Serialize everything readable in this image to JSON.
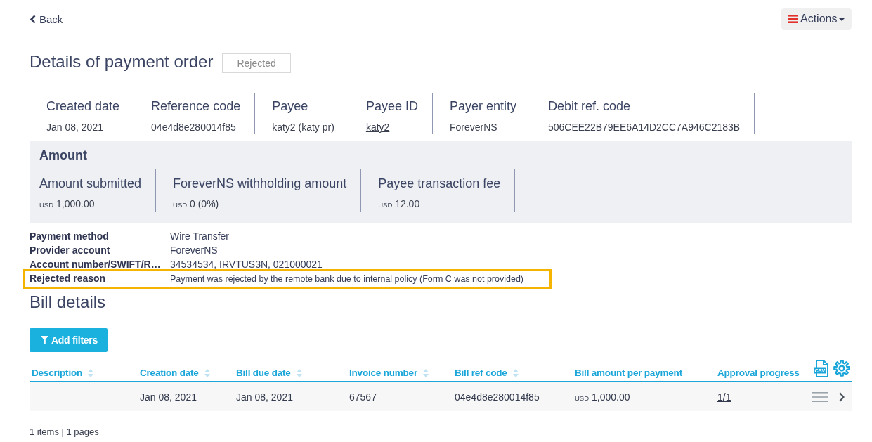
{
  "top_bar": {
    "back_label": "Back",
    "actions_label": "Actions"
  },
  "header": {
    "title": "Details of payment order",
    "status": "Rejected"
  },
  "summary": [
    {
      "label": "Created date",
      "value": "Jan 08, 2021",
      "kind": "text"
    },
    {
      "label": "Reference code",
      "value": "04e4d8e280014f85",
      "kind": "text"
    },
    {
      "label": "Payee",
      "value": "katy2 (katy pr)",
      "kind": "text"
    },
    {
      "label": "Payee ID",
      "value": "katy2",
      "kind": "link"
    },
    {
      "label": "Payer entity",
      "value": "ForeverNS",
      "kind": "text"
    },
    {
      "label": "Debit ref. code",
      "value": "506CEE22B79EE6A14D2CC7A946C2183B",
      "kind": "text"
    }
  ],
  "amount_panel": {
    "title": "Amount",
    "fields": [
      {
        "label": "Amount submitted",
        "currency": "USD",
        "value": "1,000.00"
      },
      {
        "label": "ForeverNS withholding amount",
        "currency": "USD",
        "value": "0 (0%)"
      },
      {
        "label": "Payee transaction fee",
        "currency": "USD",
        "value": "12.00"
      }
    ]
  },
  "details": [
    {
      "label": "Payment method",
      "value": "Wire Transfer",
      "highlighted": false
    },
    {
      "label": "Provider account",
      "value": "ForeverNS",
      "highlighted": false
    },
    {
      "label": "Account number/SWIFT/R…",
      "value": "34534534, IRVTUS3N, 021000021",
      "highlighted": false
    },
    {
      "label": "Rejected reason",
      "value": "Payment was rejected by the remote bank due to internal policy (Form C was not provided)",
      "highlighted": true
    }
  ],
  "bill_details": {
    "title": "Bill details",
    "filter_button": "Add filters",
    "table": {
      "export_label": "CSV",
      "columns": [
        {
          "label": "Description",
          "sortable": true
        },
        {
          "label": "Creation date",
          "sortable": true,
          "kind": "text"
        },
        {
          "label": "Bill due date",
          "sortable": true,
          "kind": "text"
        },
        {
          "label": "Invoice number",
          "sortable": true,
          "kind": "text"
        },
        {
          "label": "Bill ref code",
          "sortable": true,
          "kind": "text"
        },
        {
          "label": "Bill amount per payment",
          "sortable": false,
          "kind": "money"
        },
        {
          "label": "Approval progress",
          "sortable": false,
          "kind": "link"
        }
      ],
      "rows": [
        {
          "creation_date": "Jan 08, 2021",
          "bill_due_date": "Jan 08, 2021",
          "invoice_number": "67567",
          "bill_ref_code": "04e4d8e280014f85",
          "bill_amount": {
            "currency": "USD",
            "value": "1,000.00"
          },
          "approval_progress": "1/1"
        }
      ]
    },
    "pagination": "1 items | 1 pages"
  }
}
